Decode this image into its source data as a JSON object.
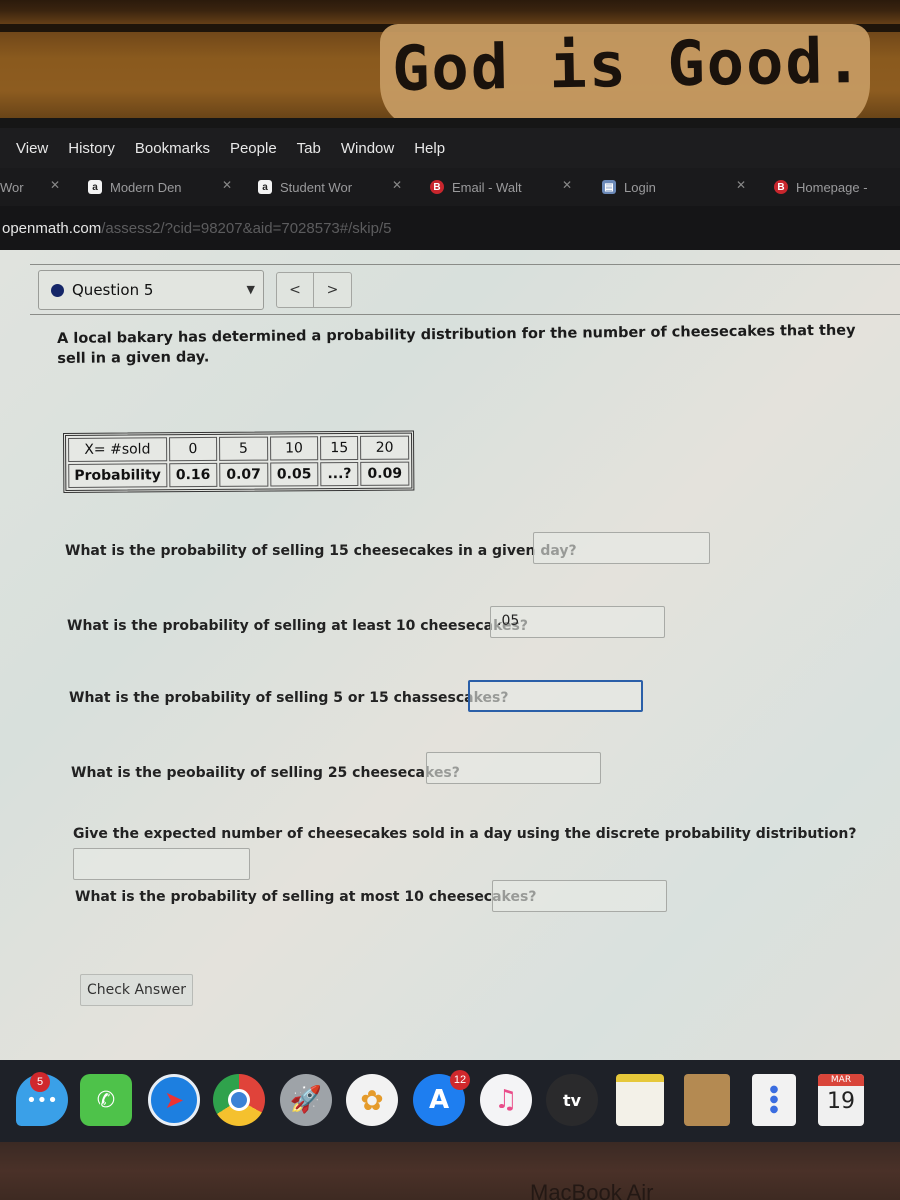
{
  "environment": {
    "wall_sign": "God is Good.",
    "laptop_label": "MacBook Air"
  },
  "menubar": {
    "items": [
      "View",
      "History",
      "Bookmarks",
      "People",
      "Tab",
      "Window",
      "Help"
    ]
  },
  "tabs": [
    {
      "label": "Wor",
      "favicon": "none"
    },
    {
      "label": "Modern Den",
      "favicon": "amazon-icon"
    },
    {
      "label": "Student Wor",
      "favicon": "amazon-icon"
    },
    {
      "label": "Email - Walt",
      "favicon": "b-icon"
    },
    {
      "label": "Login",
      "favicon": "login-icon"
    },
    {
      "label": "Homepage -",
      "favicon": "b-icon"
    }
  ],
  "address_bar": {
    "host": "openmath.com",
    "path": "/assess2/?cid=98207&aid=7028573#/skip/5"
  },
  "question_nav": {
    "selected": "Question 5",
    "prev_label": "<",
    "next_label": ">"
  },
  "intro": "A local bakary has determined a probability distribution for the number of cheesecakes that they sell in a given day.",
  "table": {
    "row_headers": [
      "X= #sold",
      "Probability"
    ],
    "x_values": [
      "0",
      "5",
      "10",
      "15",
      "20"
    ],
    "probabilities": [
      "0.16",
      "0.07",
      "0.05",
      "...?",
      "0.09"
    ]
  },
  "questions": [
    {
      "text": "What is the probability of selling 15 cheesecakes in a given day?",
      "value": ""
    },
    {
      "text": "What is the probability of selling at least 10 cheesecakes?",
      "value": ".05"
    },
    {
      "text": "What is the probability of selling 5 or 15 chassescakes?",
      "value": ""
    },
    {
      "text": "What is the peobaility of selling 25 cheesecakes?",
      "value": ""
    },
    {
      "text": "Give the expected number of cheesecakes sold in a day using the discrete probability distribution?",
      "value": ""
    },
    {
      "text": "What is the probability of selling at most 10 cheesecakes?",
      "value": ""
    }
  ],
  "check_answer_label": "Check Answer",
  "dock": {
    "apps": [
      "Messages",
      "FaceTime",
      "Safari",
      "Chrome",
      "Launchpad",
      "Photos",
      "App Store",
      "Music",
      "TV",
      "Notes",
      "Contacts",
      "Reminders",
      "Calendar"
    ],
    "messages_badge": "5",
    "appstore_badge": "12",
    "tv_label": "tv",
    "calendar_month": "MAR",
    "calendar_day": "19"
  }
}
